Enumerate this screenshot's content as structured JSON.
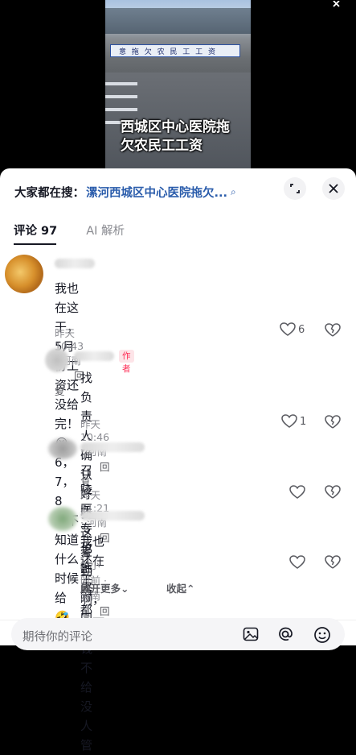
{
  "video": {
    "caption": "西城区中心医院拖欠农民工工资",
    "banner_text": "意 拖 欠 农 民 工 工 资"
  },
  "search": {
    "prefix": "大家都在搜：",
    "query": "漯河西城区中心医院拖欠...",
    "arrow": "⌕"
  },
  "tabs": [
    {
      "label": "评论 97"
    },
    {
      "label": "AI 解析"
    }
  ],
  "comments": [
    {
      "text_line1": "我也在这干，5月份工资还没给完！😭6，7，8",
      "text_line2": "还不知道什么时候给🤣",
      "time": "昨天 10:43 · 河南",
      "reply": "回复",
      "likes": "6"
    },
    {
      "author_tag": "作者",
      "text_line1": "找负责人确认好 我这考勤啥都有 钱不给 没",
      "text_line2": "人管",
      "time": "昨天 10:46 · 河南",
      "reply": "回复",
      "likes": "1"
    },
    {
      "text_line1": "召陵医专也拖欠",
      "time": "昨天 11:21 · 河南",
      "reply": "回复"
    },
    {
      "text_line1": "我也还在干啊，同一班组",
      "time": "2 小时前 · 河南",
      "reply": "回复"
    }
  ],
  "expand": {
    "more": "展开更多⌄",
    "collapse": "收起⌃"
  },
  "input": {
    "placeholder": "期待你的评论"
  },
  "colors": {
    "link_blue": "#2a5cab",
    "author_tag": "#fe2c55"
  }
}
